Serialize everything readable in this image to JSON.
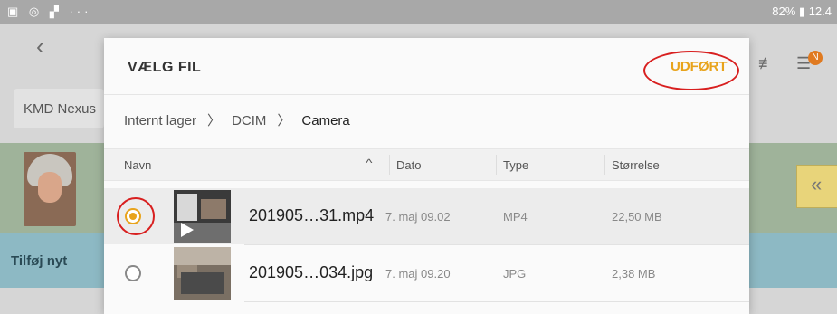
{
  "statusbar": {
    "right_text": "82% ▮ 12.4"
  },
  "background": {
    "tab_label": "KMD Nexus",
    "section_label": "Tilføj nyt",
    "badge": "N"
  },
  "dialog": {
    "title": "VÆLG FIL",
    "done_label": "UDFØRT",
    "breadcrumb": [
      "Internt lager",
      "DCIM",
      "Camera"
    ],
    "columns": {
      "name": "Navn",
      "date": "Dato",
      "type": "Type",
      "size": "Størrelse"
    },
    "files": [
      {
        "name": "201905…31.mp4",
        "date": "7. maj 09.02",
        "type": "MP4",
        "size": "22,50 MB",
        "selected": true
      },
      {
        "name": "201905…034.jpg",
        "date": "7. maj 09.20",
        "type": "JPG",
        "size": "2,38 MB",
        "selected": false
      }
    ]
  },
  "colors": {
    "accent": "#e8a31b",
    "annotation": "#d81f1f"
  }
}
